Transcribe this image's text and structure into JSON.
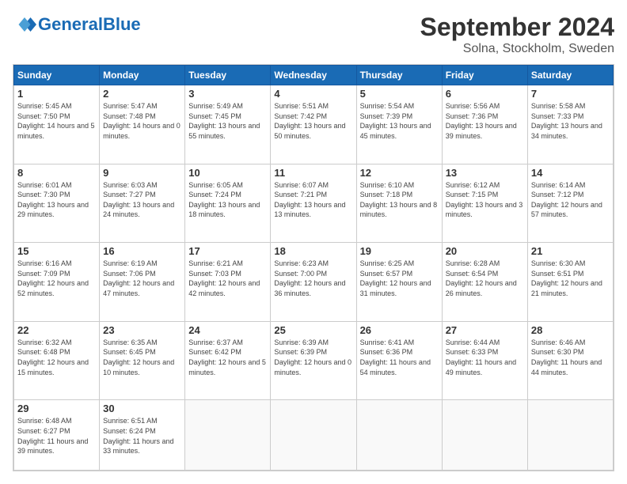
{
  "header": {
    "logo_text_normal": "General",
    "logo_text_blue": "Blue",
    "main_title": "September 2024",
    "sub_title": "Solna, Stockholm, Sweden"
  },
  "calendar": {
    "days_of_week": [
      "Sunday",
      "Monday",
      "Tuesday",
      "Wednesday",
      "Thursday",
      "Friday",
      "Saturday"
    ],
    "weeks": [
      [
        {
          "day": "1",
          "sunrise": "Sunrise: 5:45 AM",
          "sunset": "Sunset: 7:50 PM",
          "daylight": "Daylight: 14 hours and 5 minutes."
        },
        {
          "day": "2",
          "sunrise": "Sunrise: 5:47 AM",
          "sunset": "Sunset: 7:48 PM",
          "daylight": "Daylight: 14 hours and 0 minutes."
        },
        {
          "day": "3",
          "sunrise": "Sunrise: 5:49 AM",
          "sunset": "Sunset: 7:45 PM",
          "daylight": "Daylight: 13 hours and 55 minutes."
        },
        {
          "day": "4",
          "sunrise": "Sunrise: 5:51 AM",
          "sunset": "Sunset: 7:42 PM",
          "daylight": "Daylight: 13 hours and 50 minutes."
        },
        {
          "day": "5",
          "sunrise": "Sunrise: 5:54 AM",
          "sunset": "Sunset: 7:39 PM",
          "daylight": "Daylight: 13 hours and 45 minutes."
        },
        {
          "day": "6",
          "sunrise": "Sunrise: 5:56 AM",
          "sunset": "Sunset: 7:36 PM",
          "daylight": "Daylight: 13 hours and 39 minutes."
        },
        {
          "day": "7",
          "sunrise": "Sunrise: 5:58 AM",
          "sunset": "Sunset: 7:33 PM",
          "daylight": "Daylight: 13 hours and 34 minutes."
        }
      ],
      [
        {
          "day": "8",
          "sunrise": "Sunrise: 6:01 AM",
          "sunset": "Sunset: 7:30 PM",
          "daylight": "Daylight: 13 hours and 29 minutes."
        },
        {
          "day": "9",
          "sunrise": "Sunrise: 6:03 AM",
          "sunset": "Sunset: 7:27 PM",
          "daylight": "Daylight: 13 hours and 24 minutes."
        },
        {
          "day": "10",
          "sunrise": "Sunrise: 6:05 AM",
          "sunset": "Sunset: 7:24 PM",
          "daylight": "Daylight: 13 hours and 18 minutes."
        },
        {
          "day": "11",
          "sunrise": "Sunrise: 6:07 AM",
          "sunset": "Sunset: 7:21 PM",
          "daylight": "Daylight: 13 hours and 13 minutes."
        },
        {
          "day": "12",
          "sunrise": "Sunrise: 6:10 AM",
          "sunset": "Sunset: 7:18 PM",
          "daylight": "Daylight: 13 hours and 8 minutes."
        },
        {
          "day": "13",
          "sunrise": "Sunrise: 6:12 AM",
          "sunset": "Sunset: 7:15 PM",
          "daylight": "Daylight: 13 hours and 3 minutes."
        },
        {
          "day": "14",
          "sunrise": "Sunrise: 6:14 AM",
          "sunset": "Sunset: 7:12 PM",
          "daylight": "Daylight: 12 hours and 57 minutes."
        }
      ],
      [
        {
          "day": "15",
          "sunrise": "Sunrise: 6:16 AM",
          "sunset": "Sunset: 7:09 PM",
          "daylight": "Daylight: 12 hours and 52 minutes."
        },
        {
          "day": "16",
          "sunrise": "Sunrise: 6:19 AM",
          "sunset": "Sunset: 7:06 PM",
          "daylight": "Daylight: 12 hours and 47 minutes."
        },
        {
          "day": "17",
          "sunrise": "Sunrise: 6:21 AM",
          "sunset": "Sunset: 7:03 PM",
          "daylight": "Daylight: 12 hours and 42 minutes."
        },
        {
          "day": "18",
          "sunrise": "Sunrise: 6:23 AM",
          "sunset": "Sunset: 7:00 PM",
          "daylight": "Daylight: 12 hours and 36 minutes."
        },
        {
          "day": "19",
          "sunrise": "Sunrise: 6:25 AM",
          "sunset": "Sunset: 6:57 PM",
          "daylight": "Daylight: 12 hours and 31 minutes."
        },
        {
          "day": "20",
          "sunrise": "Sunrise: 6:28 AM",
          "sunset": "Sunset: 6:54 PM",
          "daylight": "Daylight: 12 hours and 26 minutes."
        },
        {
          "day": "21",
          "sunrise": "Sunrise: 6:30 AM",
          "sunset": "Sunset: 6:51 PM",
          "daylight": "Daylight: 12 hours and 21 minutes."
        }
      ],
      [
        {
          "day": "22",
          "sunrise": "Sunrise: 6:32 AM",
          "sunset": "Sunset: 6:48 PM",
          "daylight": "Daylight: 12 hours and 15 minutes."
        },
        {
          "day": "23",
          "sunrise": "Sunrise: 6:35 AM",
          "sunset": "Sunset: 6:45 PM",
          "daylight": "Daylight: 12 hours and 10 minutes."
        },
        {
          "day": "24",
          "sunrise": "Sunrise: 6:37 AM",
          "sunset": "Sunset: 6:42 PM",
          "daylight": "Daylight: 12 hours and 5 minutes."
        },
        {
          "day": "25",
          "sunrise": "Sunrise: 6:39 AM",
          "sunset": "Sunset: 6:39 PM",
          "daylight": "Daylight: 12 hours and 0 minutes."
        },
        {
          "day": "26",
          "sunrise": "Sunrise: 6:41 AM",
          "sunset": "Sunset: 6:36 PM",
          "daylight": "Daylight: 11 hours and 54 minutes."
        },
        {
          "day": "27",
          "sunrise": "Sunrise: 6:44 AM",
          "sunset": "Sunset: 6:33 PM",
          "daylight": "Daylight: 11 hours and 49 minutes."
        },
        {
          "day": "28",
          "sunrise": "Sunrise: 6:46 AM",
          "sunset": "Sunset: 6:30 PM",
          "daylight": "Daylight: 11 hours and 44 minutes."
        }
      ],
      [
        {
          "day": "29",
          "sunrise": "Sunrise: 6:48 AM",
          "sunset": "Sunset: 6:27 PM",
          "daylight": "Daylight: 11 hours and 39 minutes."
        },
        {
          "day": "30",
          "sunrise": "Sunrise: 6:51 AM",
          "sunset": "Sunset: 6:24 PM",
          "daylight": "Daylight: 11 hours and 33 minutes."
        },
        {
          "day": "",
          "sunrise": "",
          "sunset": "",
          "daylight": ""
        },
        {
          "day": "",
          "sunrise": "",
          "sunset": "",
          "daylight": ""
        },
        {
          "day": "",
          "sunrise": "",
          "sunset": "",
          "daylight": ""
        },
        {
          "day": "",
          "sunrise": "",
          "sunset": "",
          "daylight": ""
        },
        {
          "day": "",
          "sunrise": "",
          "sunset": "",
          "daylight": ""
        }
      ]
    ]
  }
}
